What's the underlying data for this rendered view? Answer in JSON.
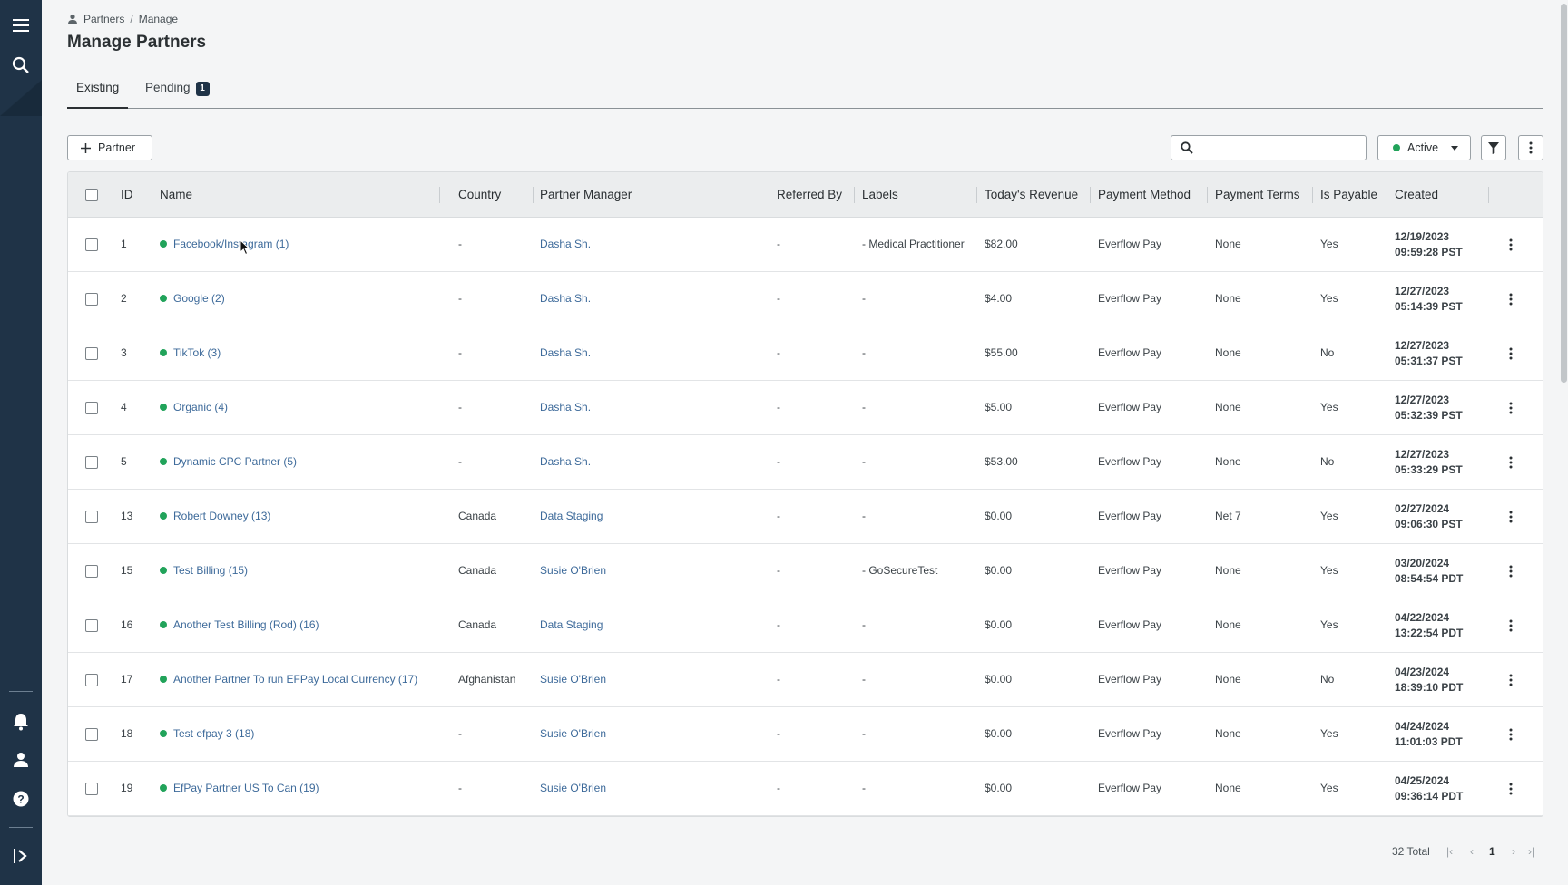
{
  "breadcrumb": {
    "root": "Partners",
    "separator": "/",
    "current": "Manage"
  },
  "page_title": "Manage Partners",
  "tabs": [
    {
      "label": "Existing",
      "active": true
    },
    {
      "label": "Pending",
      "badge": "1",
      "active": false
    }
  ],
  "toolbar": {
    "add_partner_label": "Partner",
    "search_placeholder": "",
    "status_filter": "Active"
  },
  "table": {
    "columns": [
      "ID",
      "Name",
      "Country",
      "Partner Manager",
      "Referred By",
      "Labels",
      "Today's Revenue",
      "Payment Method",
      "Payment Terms",
      "Is Payable",
      "Created"
    ],
    "rows": [
      {
        "id": "1",
        "name": "Facebook/Instagram (1)",
        "country": "-",
        "manager": "Dasha Sh.",
        "referred_by": "-",
        "labels": "- Medical Practitioner",
        "revenue": "$82.00",
        "payment_method": "Everflow Pay",
        "payment_terms": "None",
        "is_payable": "Yes",
        "created_date": "12/19/2023",
        "created_time": "09:59:28 PST"
      },
      {
        "id": "2",
        "name": "Google (2)",
        "country": "-",
        "manager": "Dasha Sh.",
        "referred_by": "-",
        "labels": "-",
        "revenue": "$4.00",
        "payment_method": "Everflow Pay",
        "payment_terms": "None",
        "is_payable": "Yes",
        "created_date": "12/27/2023",
        "created_time": "05:14:39 PST"
      },
      {
        "id": "3",
        "name": "TikTok (3)",
        "country": "-",
        "manager": "Dasha Sh.",
        "referred_by": "-",
        "labels": "-",
        "revenue": "$55.00",
        "payment_method": "Everflow Pay",
        "payment_terms": "None",
        "is_payable": "No",
        "created_date": "12/27/2023",
        "created_time": "05:31:37 PST"
      },
      {
        "id": "4",
        "name": "Organic (4)",
        "country": "-",
        "manager": "Dasha Sh.",
        "referred_by": "-",
        "labels": "-",
        "revenue": "$5.00",
        "payment_method": "Everflow Pay",
        "payment_terms": "None",
        "is_payable": "Yes",
        "created_date": "12/27/2023",
        "created_time": "05:32:39 PST"
      },
      {
        "id": "5",
        "name": "Dynamic CPC Partner (5)",
        "country": "-",
        "manager": "Dasha Sh.",
        "referred_by": "-",
        "labels": "-",
        "revenue": "$53.00",
        "payment_method": "Everflow Pay",
        "payment_terms": "None",
        "is_payable": "No",
        "created_date": "12/27/2023",
        "created_time": "05:33:29 PST"
      },
      {
        "id": "13",
        "name": "Robert Downey (13)",
        "country": "Canada",
        "manager": "Data Staging",
        "referred_by": "-",
        "labels": "-",
        "revenue": "$0.00",
        "payment_method": "Everflow Pay",
        "payment_terms": "Net 7",
        "is_payable": "Yes",
        "created_date": "02/27/2024",
        "created_time": "09:06:30 PST"
      },
      {
        "id": "15",
        "name": "Test Billing (15)",
        "country": "Canada",
        "manager": "Susie O'Brien",
        "referred_by": "-",
        "labels": "- GoSecureTest",
        "revenue": "$0.00",
        "payment_method": "Everflow Pay",
        "payment_terms": "None",
        "is_payable": "Yes",
        "created_date": "03/20/2024",
        "created_time": "08:54:54 PDT"
      },
      {
        "id": "16",
        "name": "Another Test Billing (Rod) (16)",
        "country": "Canada",
        "manager": "Data Staging",
        "referred_by": "-",
        "labels": "-",
        "revenue": "$0.00",
        "payment_method": "Everflow Pay",
        "payment_terms": "None",
        "is_payable": "Yes",
        "created_date": "04/22/2024",
        "created_time": "13:22:54 PDT"
      },
      {
        "id": "17",
        "name": "Another Partner To run EFPay Local Currency (17)",
        "country": "Afghanistan",
        "manager": "Susie O'Brien",
        "referred_by": "-",
        "labels": "-",
        "revenue": "$0.00",
        "payment_method": "Everflow Pay",
        "payment_terms": "None",
        "is_payable": "No",
        "created_date": "04/23/2024",
        "created_time": "18:39:10 PDT"
      },
      {
        "id": "18",
        "name": "Test efpay 3 (18)",
        "country": "-",
        "manager": "Susie O'Brien",
        "referred_by": "-",
        "labels": "-",
        "revenue": "$0.00",
        "payment_method": "Everflow Pay",
        "payment_terms": "None",
        "is_payable": "Yes",
        "created_date": "04/24/2024",
        "created_time": "11:01:03 PDT"
      },
      {
        "id": "19",
        "name": "EfPay Partner US To Can (19)",
        "country": "-",
        "manager": "Susie O'Brien",
        "referred_by": "-",
        "labels": "-",
        "revenue": "$0.00",
        "payment_method": "Everflow Pay",
        "payment_terms": "None",
        "is_payable": "Yes",
        "created_date": "04/25/2024",
        "created_time": "09:36:14 PDT"
      }
    ]
  },
  "pagination": {
    "total": "32 Total",
    "current_page": "1",
    "first": "|‹",
    "prev": "‹",
    "next": "›",
    "last": "›|"
  },
  "colors": {
    "sidebar": "#1f3347",
    "link": "#3d6a9a",
    "active_dot": "#21a35a"
  }
}
